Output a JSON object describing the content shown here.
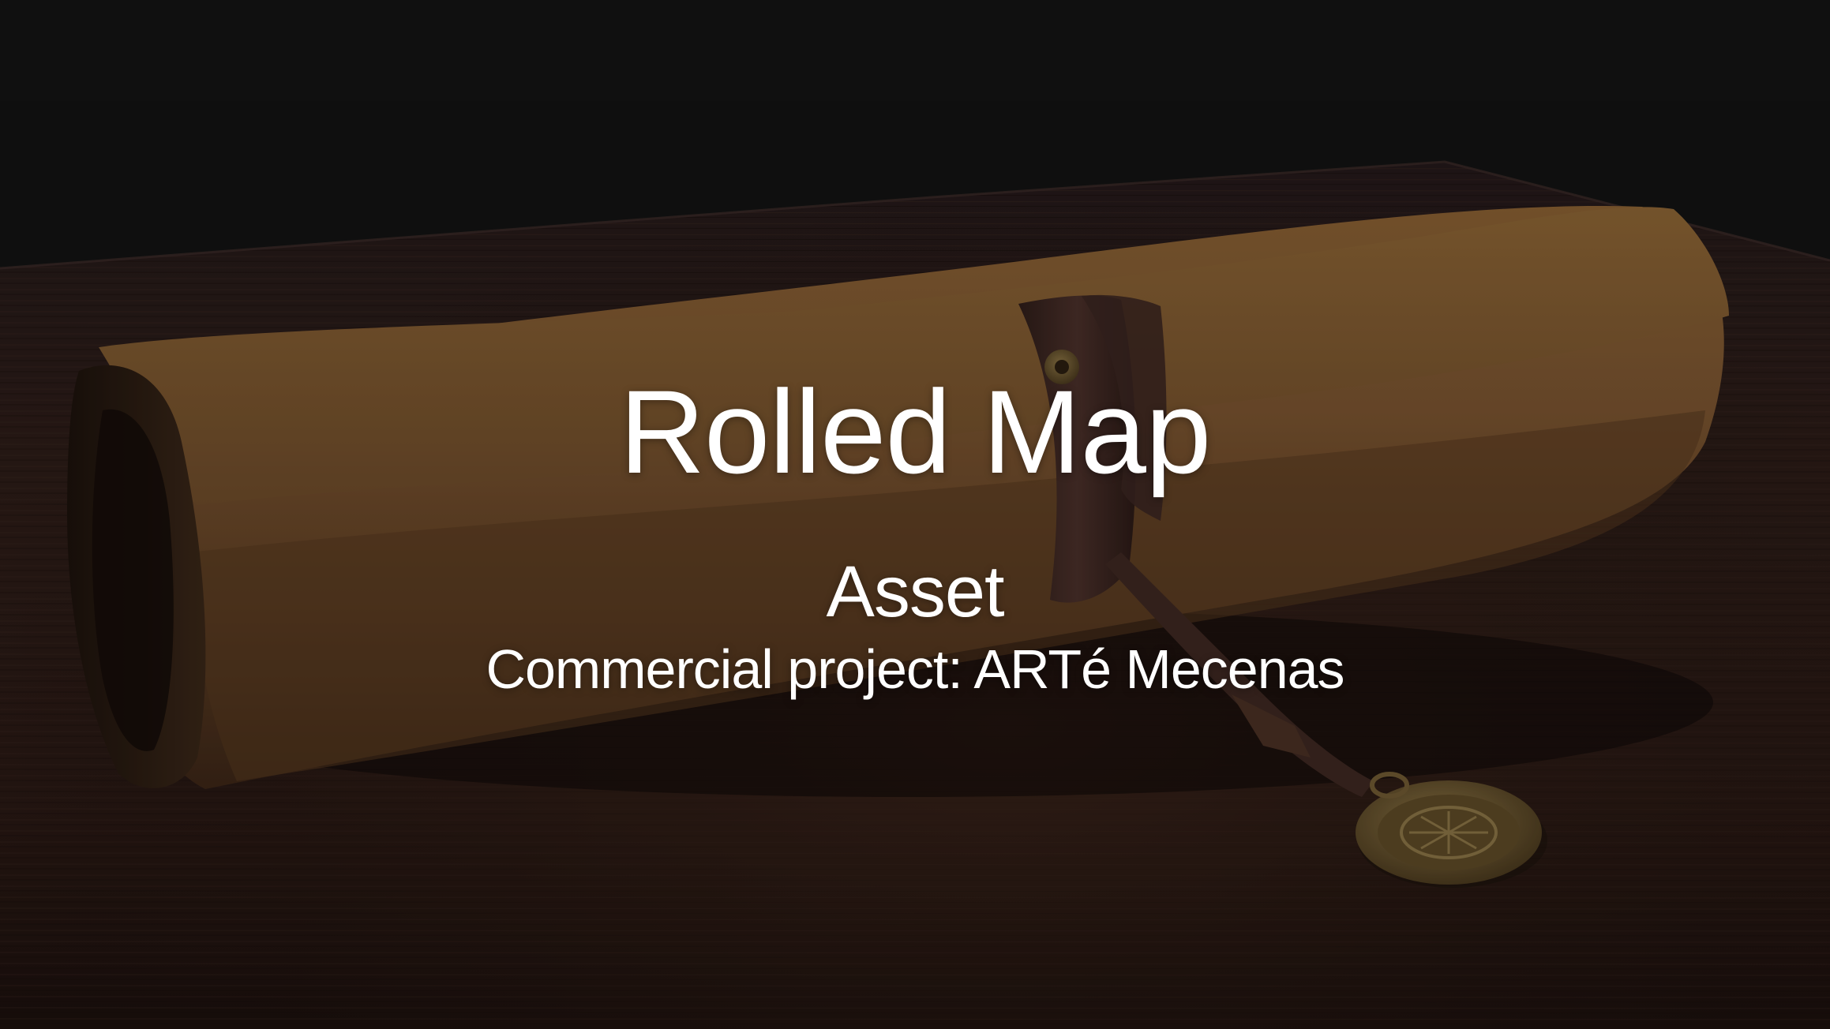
{
  "slide": {
    "title": "Rolled Map",
    "subtitle": "Asset",
    "caption": "Commercial project: ARTé Mecenas"
  },
  "colors": {
    "background": "#131313",
    "table": "#2a1c18",
    "leather": "#7a5630",
    "strap": "#3a2520",
    "brass": "#6f5a33",
    "text": "#ffffff"
  }
}
